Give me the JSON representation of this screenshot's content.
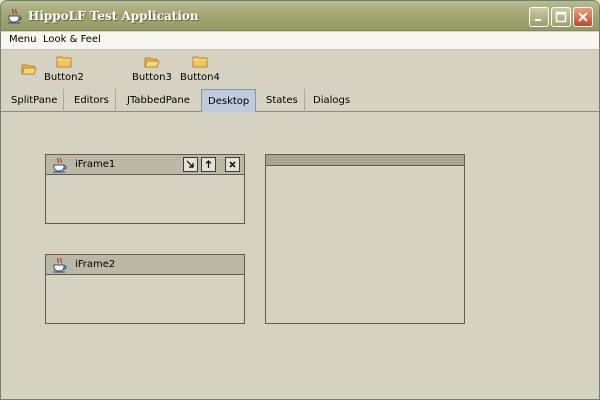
{
  "window": {
    "title": "HippoLF Test Application"
  },
  "menu": {
    "items": [
      "Menu",
      "Look & Feel"
    ]
  },
  "toolbar": {
    "buttons": [
      {
        "label": "",
        "icon": "folder-open-icon"
      },
      {
        "label": "Button2",
        "icon": "folder-icon"
      },
      {
        "label": "Button3",
        "icon": "folder-open-icon"
      },
      {
        "label": "Button4",
        "icon": "folder-icon"
      }
    ]
  },
  "tabs": {
    "items": [
      "SplitPane",
      "Editors",
      "JTabbedPane",
      "Desktop",
      "States",
      "Dialogs"
    ],
    "selected": "Desktop"
  },
  "desktop": {
    "frames": [
      {
        "title": "iFrame1",
        "icon": "java-cup-icon"
      },
      {
        "title": "iFrame2",
        "icon": "java-cup-icon"
      },
      {
        "title": ""
      }
    ]
  },
  "colors": {
    "title_bar": "#a2a872",
    "tab_selected": "#bdcbdc",
    "desktop_background": "#d6d2c1",
    "frame_title": "#bcb8a6"
  }
}
